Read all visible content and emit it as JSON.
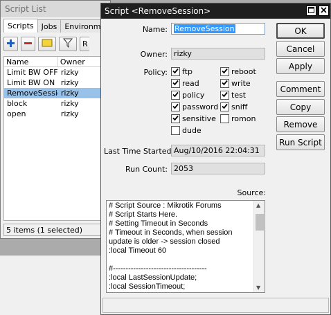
{
  "script_list": {
    "title": "Script List",
    "tabs": [
      "Scripts",
      "Jobs",
      "Environment"
    ],
    "toolbar_partial_label": "R",
    "columns": [
      "Name",
      "Owner"
    ],
    "rows": [
      {
        "name": "Limit BW OFF",
        "owner": "rizky"
      },
      {
        "name": "Limit BW ON",
        "owner": "rizky"
      },
      {
        "name": "RemoveSession",
        "owner": "rizky"
      },
      {
        "name": "block",
        "owner": "rizky"
      },
      {
        "name": "open",
        "owner": "rizky"
      }
    ],
    "status": "5 items (1 selected)"
  },
  "dialog": {
    "title": "Script <RemoveSession>",
    "name_label": "Name:",
    "name_value": "RemoveSession",
    "owner_label": "Owner:",
    "owner_value": "rizky",
    "policy_label": "Policy:",
    "policies_left": [
      {
        "label": "ftp",
        "checked": true
      },
      {
        "label": "read",
        "checked": true
      },
      {
        "label": "policy",
        "checked": true
      },
      {
        "label": "password",
        "checked": true
      },
      {
        "label": "sensitive",
        "checked": true
      },
      {
        "label": "dude",
        "checked": false
      }
    ],
    "policies_right": [
      {
        "label": "reboot",
        "checked": true
      },
      {
        "label": "write",
        "checked": true
      },
      {
        "label": "test",
        "checked": true
      },
      {
        "label": "sniff",
        "checked": true
      },
      {
        "label": "romon",
        "checked": false
      }
    ],
    "last_started_label": "Last Time Started:",
    "last_started_value": "Aug/10/2016 22:04:31",
    "run_count_label": "Run Count:",
    "run_count_value": "2053",
    "source_label": "Source:",
    "source_text": "# Script Source : Mikrotik Forums\n# Script Starts Here.\n# Setting Timeout in Seconds\n# Timeout in Seconds, when session\nupdate is older -> session closed\n:local Timeout 60\n\n#-------------------------------------\n:local LastSessionUpdate;\n:local SessionTimeout;",
    "buttons": {
      "ok": "OK",
      "cancel": "Cancel",
      "apply": "Apply",
      "comment": "Comment",
      "copy": "Copy",
      "remove": "Remove",
      "run_script": "Run Script"
    }
  },
  "colors": {
    "dialog_titlebar": "#1f1f1f",
    "selection": "#3399ff",
    "row_selected": "#99c2ea"
  }
}
